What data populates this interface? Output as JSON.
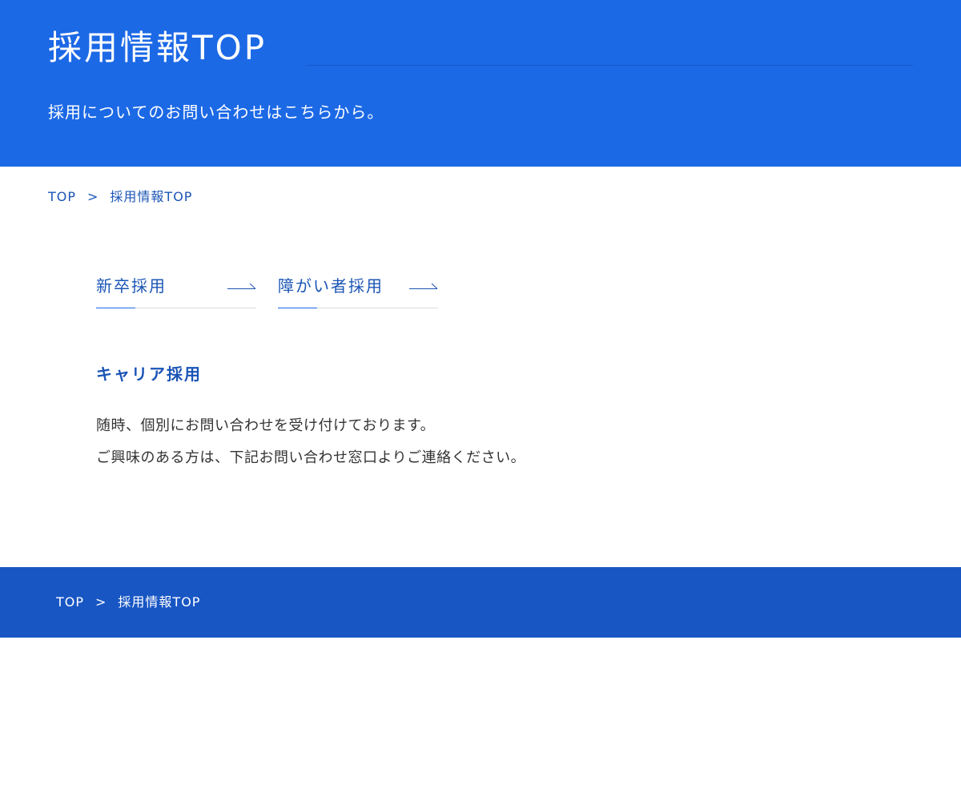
{
  "hero": {
    "title": "採用情報TOP",
    "lead": "採用についてのお問い合わせはこちらから。"
  },
  "breadcrumb": {
    "home": "TOP",
    "separator": ">",
    "current": "採用情報TOP"
  },
  "tabs": [
    {
      "label": "新卒採用",
      "icon": "arrow-right-icon"
    },
    {
      "label": "障がい者採用",
      "icon": "arrow-right-icon"
    }
  ],
  "career": {
    "heading": "キャリア採用",
    "line1": "随時、個別にお問い合わせを受け付けております。",
    "line2": "ご興味のある方は、下記お問い合わせ窓口よりご連絡ください。"
  },
  "footer_breadcrumb": {
    "home": "TOP",
    "separator": ">",
    "current": "採用情報TOP"
  },
  "colors": {
    "hero_bg": "#1c69e6",
    "footer_bg": "#1856c4",
    "link": "#1b55b5",
    "text": "#333333"
  }
}
